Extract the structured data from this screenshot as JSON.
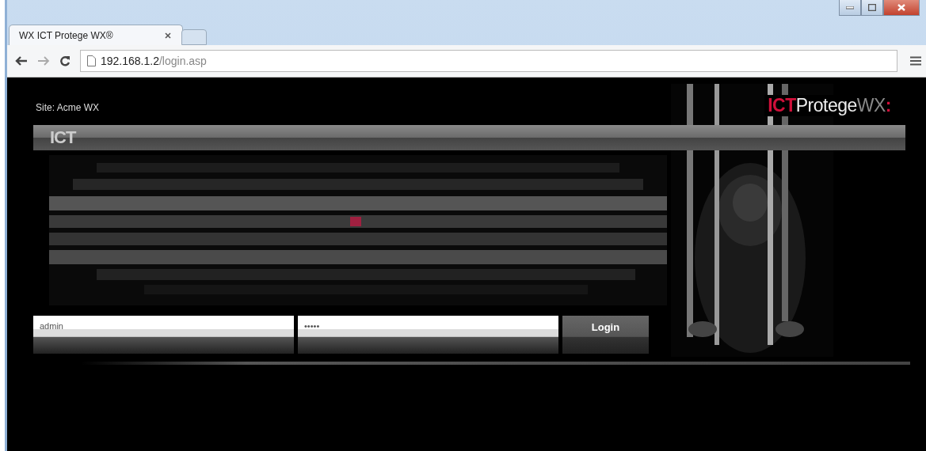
{
  "browser": {
    "tabs": [
      {
        "title": "WX ICT Protege WX®",
        "selected": true
      }
    ],
    "address": {
      "host": "192.168.1.2",
      "path": "/login.asp"
    }
  },
  "page": {
    "site": "Site: Acme WX",
    "banner_logo": "ICT",
    "brand": {
      "prefix": "ICT",
      "name": "Protege",
      "suffix": "WX",
      "mark": ":"
    },
    "login": {
      "username": "admin",
      "password": "•••••",
      "button": "Login"
    }
  }
}
